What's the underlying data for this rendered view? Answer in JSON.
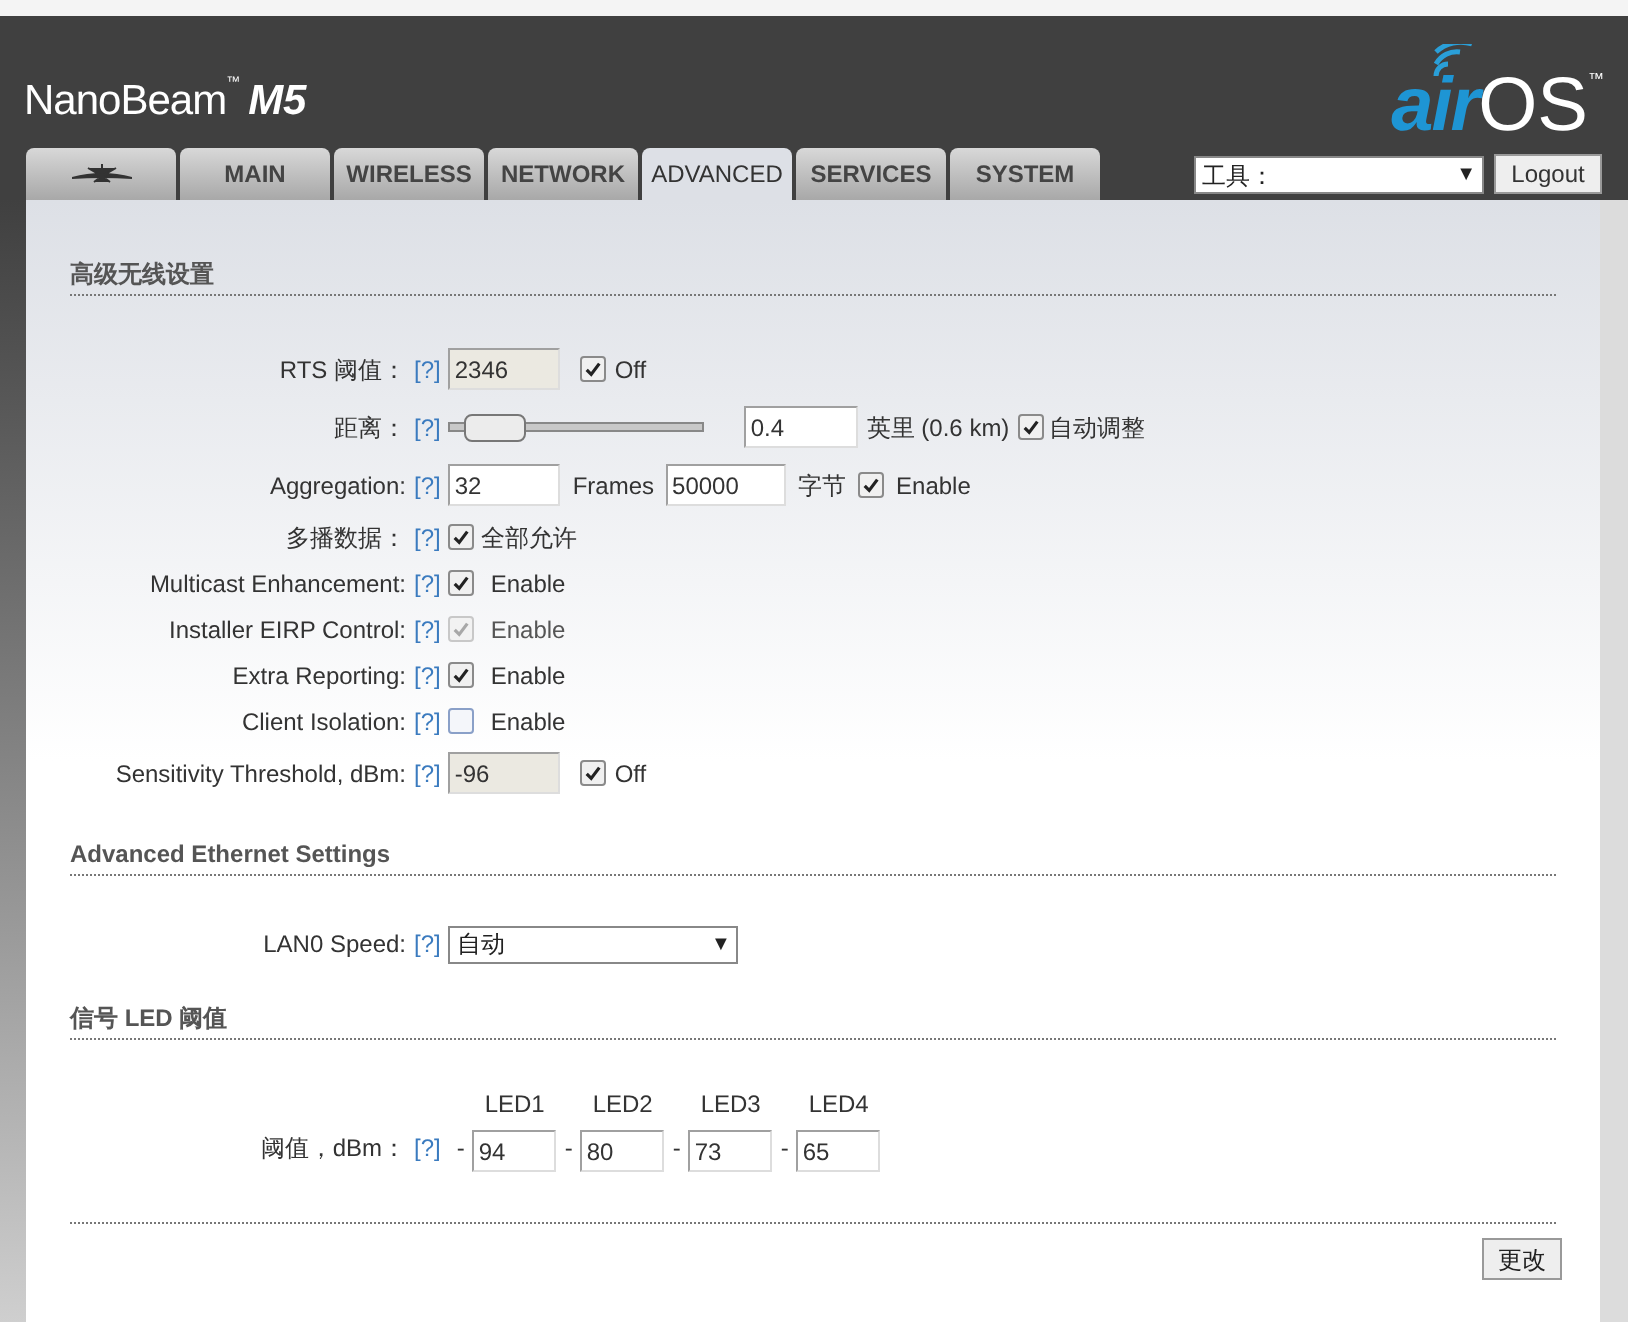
{
  "header": {
    "product": "NanoBeam",
    "product_mark": "™",
    "model": "M5",
    "brand_air": "air",
    "brand_os": "OS",
    "brand_mark": "™"
  },
  "tabs": [
    {
      "kind": "logo",
      "selected": false
    },
    {
      "kind": "text",
      "label": "MAIN",
      "selected": false
    },
    {
      "kind": "text",
      "label": "WIRELESS",
      "selected": false
    },
    {
      "kind": "text",
      "label": "NETWORK",
      "selected": false
    },
    {
      "kind": "text",
      "label": "ADVANCED",
      "selected": true
    },
    {
      "kind": "text",
      "label": "SERVICES",
      "selected": false
    },
    {
      "kind": "text",
      "label": "SYSTEM",
      "selected": false
    }
  ],
  "tools": {
    "value": "工具：",
    "arrow": "▼"
  },
  "logout": "Logout",
  "sections": [
    {
      "title": "高级无线设置",
      "rows": [
        {
          "kind": "input_check",
          "label": "RTS 阈值：",
          "help": "[?]",
          "value": "2346",
          "input_disabled": true,
          "checked": true,
          "check_label": "Off"
        },
        {
          "kind": "slider",
          "label": "距离：",
          "help": "[?]",
          "level": 0.08,
          "value": "0.4",
          "unit": "英里 (0.6 km)",
          "checked": true,
          "check_label": "自动调整"
        },
        {
          "kind": "aggregation",
          "label": "Aggregation:",
          "help": "[?]",
          "value": "32",
          "unit": "Frames",
          "value2": "50000",
          "unit2": "字节",
          "checked": true,
          "check_label": "Enable"
        },
        {
          "kind": "check",
          "label": "多播数据：",
          "help": "[?]",
          "checked": true,
          "disabled": false,
          "check_label": "全部允许"
        },
        {
          "kind": "check",
          "label": "Multicast Enhancement:",
          "help": "[?]",
          "checked": true,
          "disabled": false,
          "check_label": "Enable"
        },
        {
          "kind": "check",
          "label": "Installer EIRP Control:",
          "help": "[?]",
          "checked": true,
          "disabled": true,
          "check_label": "Enable"
        },
        {
          "kind": "check",
          "label": "Extra Reporting:",
          "help": "[?]",
          "checked": true,
          "disabled": false,
          "check_label": "Enable"
        },
        {
          "kind": "check",
          "label": "Client Isolation:",
          "help": "[?]",
          "checked": false,
          "disabled": false,
          "check_label": "Enable"
        },
        {
          "kind": "input_check",
          "label": "Sensitivity Threshold, dBm:",
          "help": "[?]",
          "value": "-96",
          "input_disabled": true,
          "checked": true,
          "check_label": "Off"
        }
      ]
    },
    {
      "title": "Advanced Ethernet Settings",
      "rows": [
        {
          "kind": "select",
          "label": "LAN0 Speed:",
          "help": "[?]",
          "value": "自动",
          "arrow": "▼"
        }
      ]
    },
    {
      "title": "信号 LED 阈值",
      "rows": [
        {
          "kind": "leds",
          "label": "阈值，dBm：",
          "help": "[?]",
          "leds": [
            {
              "name": "LED1",
              "dash": "-",
              "value": "94"
            },
            {
              "name": "LED2",
              "dash": "-",
              "value": "80"
            },
            {
              "name": "LED3",
              "dash": "-",
              "value": "73"
            },
            {
              "name": "LED4",
              "dash": "-",
              "value": "65"
            }
          ]
        }
      ]
    }
  ],
  "apply": "更改"
}
